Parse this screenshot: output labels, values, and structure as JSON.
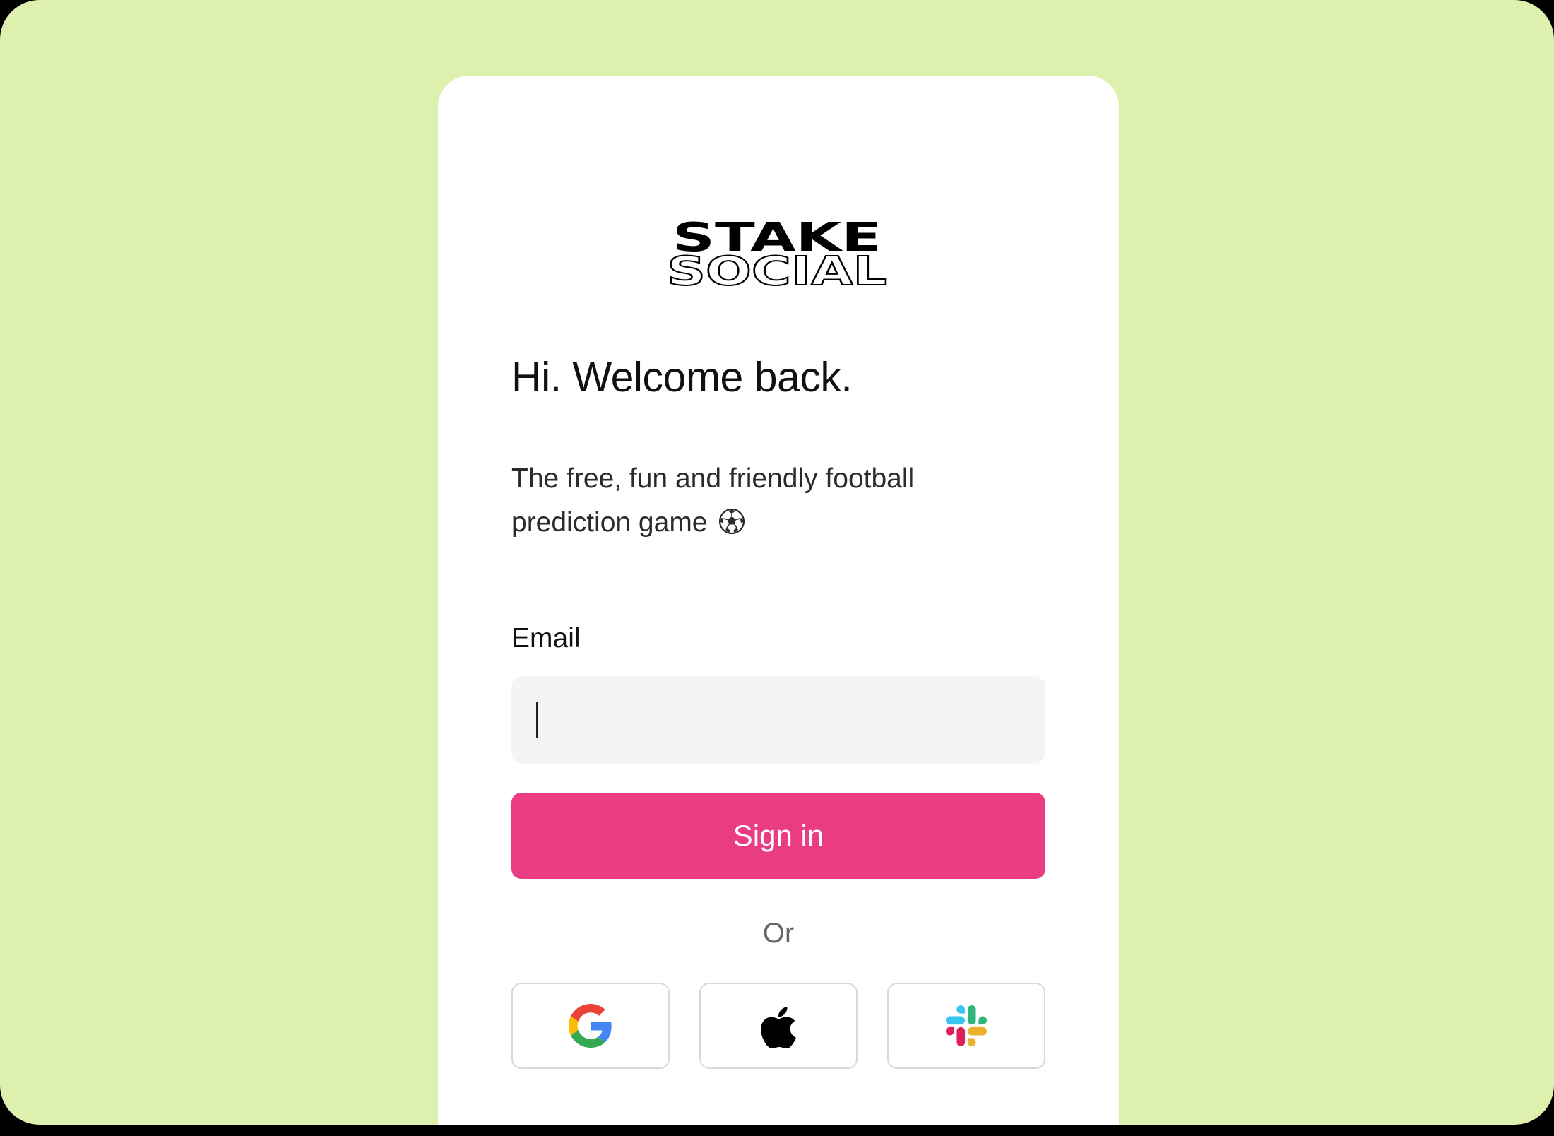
{
  "brand": {
    "logo_line1": "STAKE",
    "logo_line2": "SOCIAL"
  },
  "login": {
    "heading": "Hi. Welcome back.",
    "subtitle": "The free, fun and friendly football prediction game",
    "email_label": "Email",
    "email_value": "",
    "signin_label": "Sign in",
    "or_label": "Or"
  },
  "social_buttons": [
    {
      "icon": "google-icon"
    },
    {
      "icon": "apple-icon"
    },
    {
      "icon": "slack-icon"
    }
  ],
  "colors": {
    "background": "#ddf0ad",
    "card": "#ffffff",
    "primary_button": "#e93c82",
    "input_background": "#f4f4f4"
  }
}
